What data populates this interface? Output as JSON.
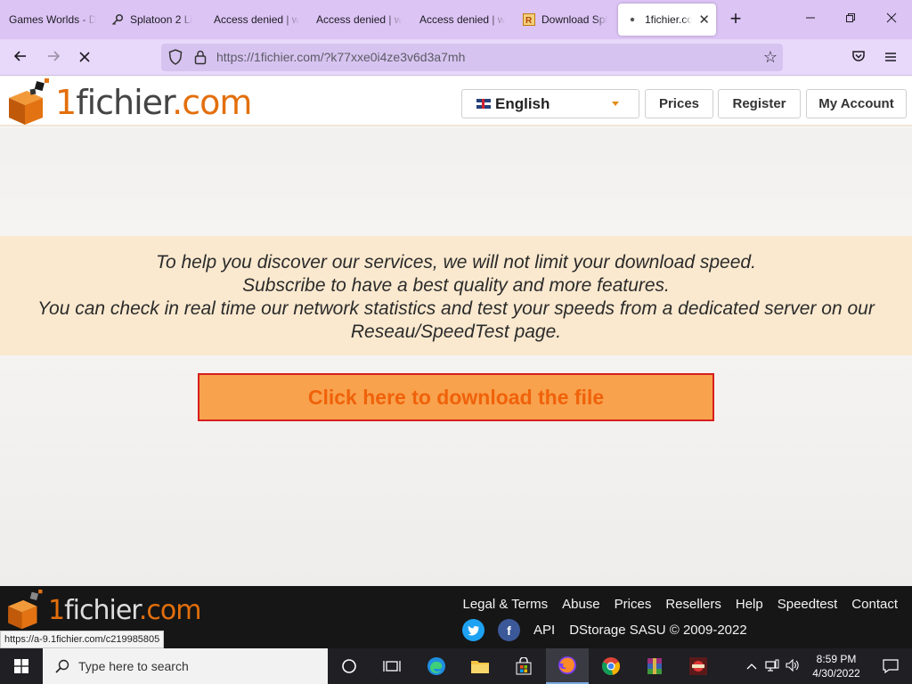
{
  "browser": {
    "tabs": [
      {
        "label": "Games Worlds - D",
        "icon": "none"
      },
      {
        "label": "Splatoon 2 Li",
        "icon": "key-icon"
      },
      {
        "label": "Access denied | w",
        "icon": "none"
      },
      {
        "label": "Access denied | w",
        "icon": "none"
      },
      {
        "label": "Access denied | w",
        "icon": "none"
      },
      {
        "label": "Download Spl",
        "icon": "r-site-icon"
      },
      {
        "label": "1fichier.cor",
        "icon": "loading-dot-icon",
        "active": true
      }
    ],
    "url": "https://1fichier.com/?k77xxe0i4ze3v6d3a7mh"
  },
  "site": {
    "logo": {
      "one": "1",
      "fichier": "fichier",
      "com": ".com"
    },
    "language": "English",
    "nav": {
      "prices": "Prices",
      "register": "Register",
      "account": "My Account"
    },
    "promo": [
      "To help you discover our services, we will not limit your download speed.",
      "Subscribe to have a best quality and more features.",
      "You can check in real time our network statistics and test your speeds from a dedicated server on our",
      "Reseau/SpeedTest page."
    ],
    "download_button": "Click here to download the file",
    "footer": {
      "links": [
        "Legal & Terms",
        "Abuse",
        "Prices",
        "Resellers",
        "Help",
        "Speedtest",
        "Contact"
      ],
      "api": "API",
      "copyright": "DStorage SASU © 2009-2022"
    },
    "status_url": "https://a-9.1fichier.com/c219985805"
  },
  "taskbar": {
    "search_placeholder": "Type here to search",
    "time": "8:59 PM",
    "date": "4/30/2022"
  },
  "colors": {
    "accent_orange": "#e36f0c",
    "download_border": "#d61f1f",
    "promo_bg": "#fae9cf",
    "tabbar": "#dcc4f4"
  }
}
